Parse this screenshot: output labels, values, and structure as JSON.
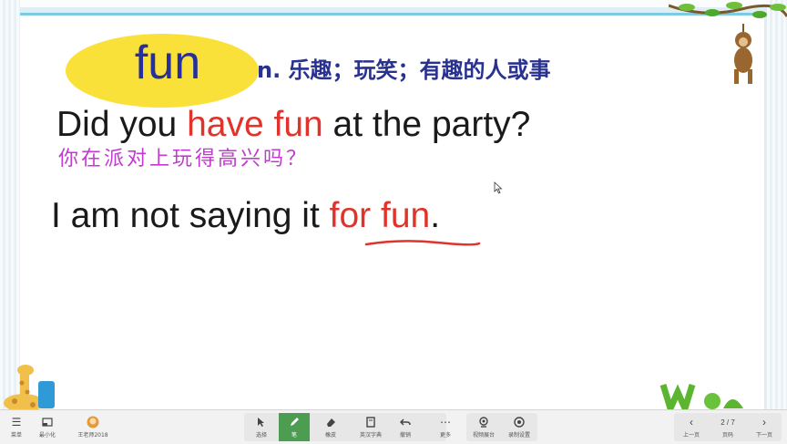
{
  "slide": {
    "word": "fun",
    "definition": "n. 乐趣；玩笑；有趣的人或事",
    "sentence1": {
      "before": "Did you ",
      "highlight": "have fun",
      "after": " at the party?"
    },
    "translation": "你在派对上玩得高兴吗？",
    "sentence2": {
      "before": "I am not saying it ",
      "highlight": "for fun",
      "after": "."
    }
  },
  "toolbar": {
    "menu_label": "菜单",
    "minimize_label": "最小化",
    "teacher_label": "王老师2018",
    "select_label": "选择",
    "pen_label": "笔",
    "eraser_label": "橡皮",
    "dictionary_label": "英汉字典",
    "undo_label": "撤销",
    "more_label": "更多",
    "camera_label": "视频展台",
    "record_label": "录制设置",
    "prev_label": "上一页",
    "page_list_label": "页码",
    "next_label": "下一页",
    "page_indicator": "2 / 7"
  },
  "colors": {
    "title_ellipse": "#f9e13a",
    "title_text": "#27309a",
    "highlight": "#e0332b",
    "translation": "#c13bd0",
    "active_tool": "#4c9d52"
  }
}
